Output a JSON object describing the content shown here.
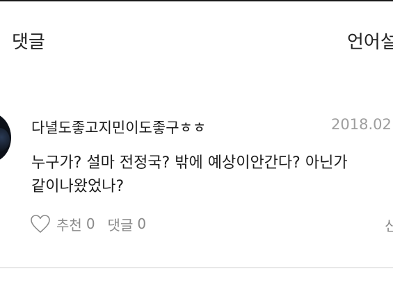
{
  "header": {
    "title": "댓글",
    "language": "언어설"
  },
  "comment": {
    "username": "다녈도좋고지민이도좋구ㅎㅎ",
    "date": "2018.02.",
    "text_line1": "누구가? 설마 전정국? 밖에 예상이안간다? 아닌가",
    "text_line2": "같이나왔었나?",
    "like_label": "추천",
    "like_count": "0",
    "reply_label": "댓글",
    "reply_count": "0",
    "trailing_text": "신"
  },
  "icons": {
    "like": "heart-outline-icon"
  },
  "colors": {
    "text": "#1c1c1c",
    "muted": "#8a8a8a",
    "date": "#9e9e9e",
    "divider": "#e8e8e8"
  }
}
